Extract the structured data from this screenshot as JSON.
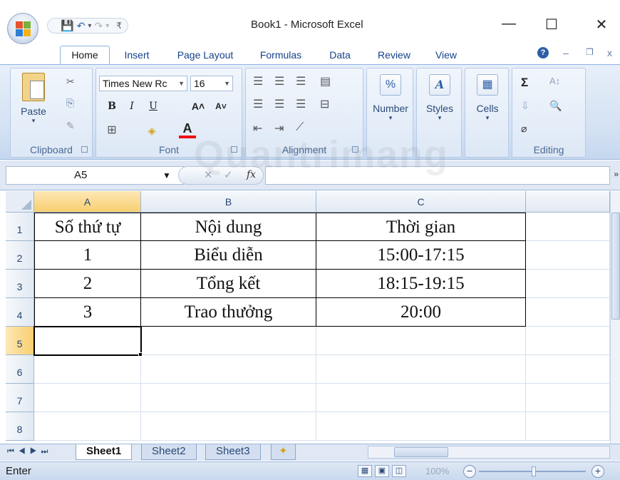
{
  "window": {
    "title": "Book1 - Microsoft Excel",
    "minimize": "—",
    "maximize": "☐",
    "close": "✕",
    "mdi_minimize": "–",
    "mdi_restore": "❐",
    "mdi_close": "x"
  },
  "qat": {
    "save": "💾",
    "undo": "↶",
    "undo_dd": "▾",
    "redo": "↷",
    "redo_dd": "▾",
    "customize": "₹"
  },
  "ribbon_tabs": [
    "Home",
    "Insert",
    "Page Layout",
    "Formulas",
    "Data",
    "Review",
    "View"
  ],
  "help_icon": "?",
  "clipboard": {
    "label": "Clipboard",
    "paste": "Paste",
    "paste_dd": "▾",
    "cut": "✂",
    "copy": "⎘",
    "format_painter": "✎"
  },
  "font": {
    "label": "Font",
    "name": "Times New Rc",
    "size": "16",
    "bold": "B",
    "italic": "I",
    "underline": "U",
    "grow": "A˄",
    "shrink": "A˅",
    "borders": "⊞",
    "fill": "◈",
    "font_color": "A"
  },
  "alignment": {
    "label": "Alignment"
  },
  "number": {
    "label": "Number",
    "symbol": "%"
  },
  "styles": {
    "label": "Styles",
    "symbol": "A"
  },
  "cells": {
    "label": "Cells",
    "symbol": "▦"
  },
  "editing": {
    "label": "Editing",
    "sum": "Σ",
    "sort": "A↕",
    "fill": "⇩",
    "find": "🔍",
    "clear": "⌀"
  },
  "formula_bar": {
    "name_box": "A5",
    "fx": "fx",
    "cancel": "✕",
    "enter": "✓",
    "value": ""
  },
  "watermark": "Quantrimang",
  "columns": [
    "A",
    "B",
    "C"
  ],
  "rows": [
    "1",
    "2",
    "3",
    "4",
    "5",
    "6",
    "7",
    "8"
  ],
  "table": [
    [
      "Số thứ tự",
      "Nội dung",
      "Thời gian"
    ],
    [
      "1",
      "Biểu diễn",
      "15:00-17:15"
    ],
    [
      "2",
      "Tổng kết",
      "18:15-19:15"
    ],
    [
      "3",
      "Trao thưởng",
      "20:00"
    ]
  ],
  "sheets": [
    "Sheet1",
    "Sheet2",
    "Sheet3"
  ],
  "status": {
    "mode": "Enter",
    "zoom": "100%",
    "zoom_out": "−",
    "zoom_in": "+"
  }
}
